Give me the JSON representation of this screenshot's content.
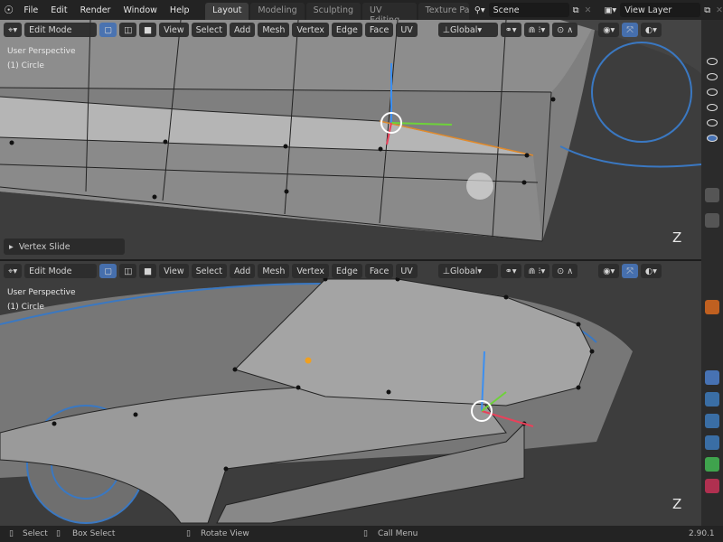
{
  "menu": [
    "File",
    "Edit",
    "Render",
    "Window",
    "Help"
  ],
  "workspaces": [
    "Layout",
    "Modeling",
    "Sculpting",
    "UV Editing",
    "Texture Pa"
  ],
  "active_workspace": "Layout",
  "scene": "Scene",
  "view_layer": "View Layer",
  "viewport_header": {
    "mode": "Edit Mode",
    "menus": [
      "View",
      "Select",
      "Add",
      "Mesh",
      "Vertex",
      "Edge",
      "Face",
      "UV"
    ],
    "orientation": "Global"
  },
  "top_viewport": {
    "perspective": "User Perspective",
    "object": "(1) Circle",
    "operator_panel": "Vertex Slide",
    "axis": "Z"
  },
  "bottom_viewport": {
    "perspective": "User Perspective",
    "object": "(1) Circle",
    "axis": "Z"
  },
  "status": {
    "select": "Select",
    "box_select": "Box Select",
    "rotate": "Rotate View",
    "call_menu": "Call Menu",
    "version": "2.90.1"
  },
  "colors": {
    "accent": "#4772b3",
    "mesh": "#8c8c8c",
    "background": "#3d3d3d",
    "wire": "#3a78c2"
  }
}
